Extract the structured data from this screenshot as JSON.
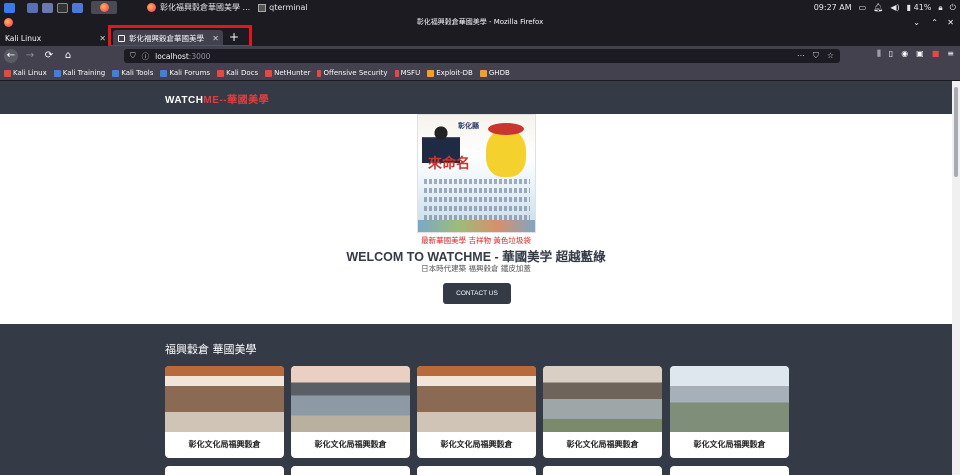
{
  "taskbar": {
    "task_firefox": "彰化福興穀倉華國美學 ...",
    "task_terminal": "qterminal",
    "time": "09:27 AM",
    "battery": "41%"
  },
  "window": {
    "title": "彰化福興穀倉華國美學 - Mozilla Firefox"
  },
  "tabs": [
    {
      "label": "Kali Linux"
    },
    {
      "label": "彰化福興穀倉華國美學"
    }
  ],
  "url": {
    "host": "localhost",
    "port": ":3000"
  },
  "bookmarks": [
    "Kali Linux",
    "Kali Training",
    "Kali Tools",
    "Kali Forums",
    "Kali Docs",
    "NetHunter",
    "Offensive Security",
    "MSFU",
    "Exploit-DB",
    "GHDB"
  ],
  "site": {
    "brand_a": "WATCH",
    "brand_b": "ME",
    "brand_c": "--華國美學",
    "poster_caption": "最新華國美學 吉祥物 黃色垃圾袋",
    "hero_title": "WELCOM TO WATCHME - 華國美学 超越藍綠",
    "hero_subtitle": "日本時代建築 福興穀倉 鐵皮加蓋",
    "contact_label": "CONTACT US",
    "gallery_title": "福興穀倉 華國美學",
    "cards": [
      {
        "label": "彰化文化局福興穀倉"
      },
      {
        "label": "彰化文化局福興穀倉"
      },
      {
        "label": "彰化文化局福興穀倉"
      },
      {
        "label": "彰化文化局福興穀倉"
      },
      {
        "label": "彰化文化局福興穀倉"
      }
    ]
  },
  "poster": {
    "title": "彰化縣",
    "big_text": "來命名"
  }
}
